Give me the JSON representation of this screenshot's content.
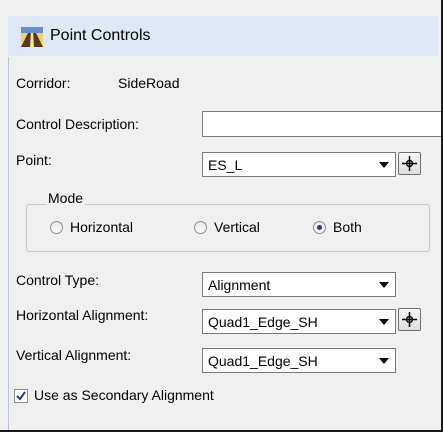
{
  "window": {
    "title": "Point Controls",
    "icon": "corridor-app-icon"
  },
  "corridor": {
    "label": "Corridor:",
    "value": "SideRoad"
  },
  "control_description": {
    "label": "Control Description:",
    "value": ""
  },
  "point": {
    "label": "Point:",
    "value": "ES_L",
    "pick_icon": "crosshair-icon"
  },
  "mode": {
    "title": "Mode",
    "options": [
      {
        "label": "Horizontal",
        "selected": false
      },
      {
        "label": "Vertical",
        "selected": false
      },
      {
        "label": "Both",
        "selected": true
      }
    ]
  },
  "control_type": {
    "label": "Control Type:",
    "value": "Alignment"
  },
  "horizontal_alignment": {
    "label": "Horizontal Alignment:",
    "value": "Quad1_Edge_SH",
    "pick_icon": "crosshair-icon"
  },
  "vertical_alignment": {
    "label": "Vertical Alignment:",
    "value": "Quad1_Edge_SH"
  },
  "secondary": {
    "label": "Use as Secondary Alignment",
    "checked": true
  }
}
